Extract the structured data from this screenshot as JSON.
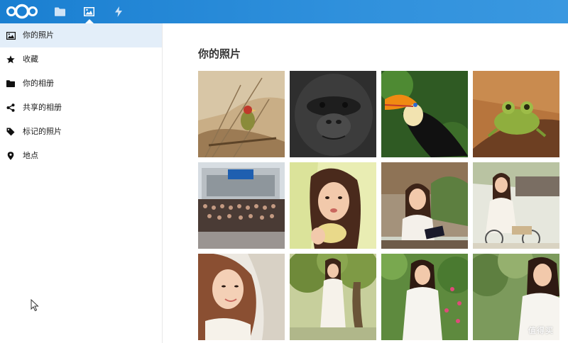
{
  "header": {
    "apps": [
      {
        "name": "files",
        "icon": "folder-icon"
      },
      {
        "name": "photos",
        "icon": "image-icon",
        "active": true
      },
      {
        "name": "activity",
        "icon": "lightning-icon"
      }
    ],
    "accent": "#1e82d3"
  },
  "sidebar": {
    "items": [
      {
        "label": "你的照片",
        "icon": "image-icon",
        "active": true
      },
      {
        "label": "收藏",
        "icon": "star-icon"
      },
      {
        "label": "你的相册",
        "icon": "folder-icon"
      },
      {
        "label": "共享的相册",
        "icon": "share-icon"
      },
      {
        "label": "标记的照片",
        "icon": "tag-icon"
      },
      {
        "label": "地点",
        "icon": "location-pin-icon"
      }
    ]
  },
  "main": {
    "title": "你的照片",
    "photos": [
      {
        "subject": "bird-on-branch"
      },
      {
        "subject": "gorilla"
      },
      {
        "subject": "toucan"
      },
      {
        "subject": "frog"
      },
      {
        "subject": "group-photo"
      },
      {
        "subject": "girl-eating"
      },
      {
        "subject": "girl-reading"
      },
      {
        "subject": "girl-bicycle"
      },
      {
        "subject": "girl-portrait"
      },
      {
        "subject": "girl-tree"
      },
      {
        "subject": "girl-garden"
      },
      {
        "subject": "girl-outdoor"
      }
    ]
  },
  "watermark": "值得买"
}
